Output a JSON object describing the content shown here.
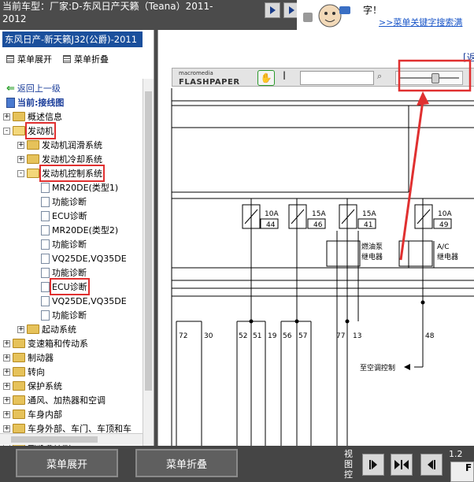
{
  "header": {
    "car_label": "当前车型：厂家:D-东风日产天籁（Teana）2011-2012"
  },
  "ad": {
    "line1": "字！",
    "line2": ">>菜单关键字搜索满"
  },
  "left_pane": {
    "title": "东风日产-新天籁J32(公爵)-2011",
    "menu_expand": "菜单展开",
    "menu_collapse": "菜单折叠",
    "back": "返回上一级",
    "current": "当前:接线图",
    "tree": [
      {
        "label": "概述信息",
        "kind": "folder",
        "pm": "+",
        "indent": 0
      },
      {
        "label": "发动机",
        "kind": "folder-open",
        "pm": "-",
        "indent": 0,
        "highlight": true
      },
      {
        "label": "发动机润滑系统",
        "kind": "folder",
        "pm": "+",
        "indent": 1
      },
      {
        "label": "发动机冷却系统",
        "kind": "folder",
        "pm": "+",
        "indent": 1
      },
      {
        "label": "发动机控制系统",
        "kind": "folder-open",
        "pm": "-",
        "indent": 1,
        "highlight": true
      },
      {
        "label": "MR20DE(类型1)",
        "kind": "doc",
        "indent": 2
      },
      {
        "label": "功能诊断",
        "kind": "doc",
        "indent": 2
      },
      {
        "label": "ECU诊断",
        "kind": "doc",
        "indent": 2
      },
      {
        "label": "MR20DE(类型2)",
        "kind": "doc",
        "indent": 2
      },
      {
        "label": "功能诊断",
        "kind": "doc",
        "indent": 2
      },
      {
        "label": "VQ25DE,VQ35DE",
        "kind": "doc",
        "indent": 2
      },
      {
        "label": "功能诊断",
        "kind": "doc",
        "indent": 2
      },
      {
        "label": "ECU诊断",
        "kind": "doc",
        "indent": 2,
        "highlight": true
      },
      {
        "label": "VQ25DE,VQ35DE",
        "kind": "doc",
        "indent": 2
      },
      {
        "label": "功能诊断",
        "kind": "doc",
        "indent": 2
      },
      {
        "label": "起动系统",
        "kind": "folder",
        "pm": "+",
        "indent": 1
      },
      {
        "label": "变速箱和传动系",
        "kind": "folder",
        "pm": "+",
        "indent": 0
      },
      {
        "label": "制动器",
        "kind": "folder",
        "pm": "+",
        "indent": 0
      },
      {
        "label": "转向",
        "kind": "folder",
        "pm": "+",
        "indent": 0
      },
      {
        "label": "保护系统",
        "kind": "folder",
        "pm": "+",
        "indent": 0
      },
      {
        "label": "通风、加热器和空调",
        "kind": "folder",
        "pm": "+",
        "indent": 0
      },
      {
        "label": "车身内部",
        "kind": "folder",
        "pm": "+",
        "indent": 0
      },
      {
        "label": "车身外部、车门、车顶和车",
        "kind": "folder",
        "pm": "+",
        "indent": 0
      },
      {
        "label": "驾驶员控制",
        "kind": "folder",
        "pm": "+",
        "indent": 0
      }
    ]
  },
  "viewer": {
    "corner_link": "[返",
    "flashpaper_small": "macromedia",
    "flashpaper_big": "FLASHPAPER",
    "zoom_level": 0.6,
    "diagram": {
      "fuses": [
        {
          "amp": "10A",
          "num": "44"
        },
        {
          "amp": "15A",
          "num": "46"
        },
        {
          "amp": "15A",
          "num": "41"
        },
        {
          "amp": "10A",
          "num": "49"
        }
      ],
      "relay_fuel": "燃油泵\n继电器",
      "relay_fuel_l1": "燃油泵",
      "relay_fuel_l2": "继电器",
      "relay_ac_l1": "A/C",
      "relay_ac_l2": "继电器",
      "pins": [
        "72",
        "30",
        "52",
        "51",
        "19",
        "56",
        "57",
        "77",
        "13",
        "48"
      ],
      "ac_control": "至空调控制"
    }
  },
  "bottom": {
    "expand": "菜单展开",
    "collapse": "菜单折叠",
    "view_label": "视图控",
    "page": "1.2"
  },
  "colors": {
    "accent_red": "#e03030",
    "title_blue": "#1a4f9c"
  }
}
